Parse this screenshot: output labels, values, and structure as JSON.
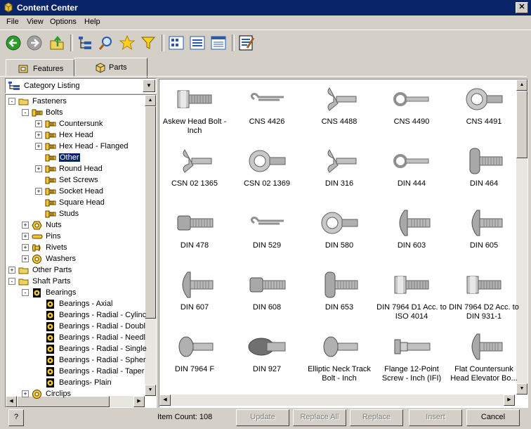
{
  "window": {
    "title": "Content Center",
    "close_glyph": "✕"
  },
  "menu": [
    "File",
    "View",
    "Options",
    "Help"
  ],
  "toolbar": {
    "buttons": [
      "back-arrow-icon",
      "forward-arrow-icon",
      "up-folder-icon",
      "tree-view-icon",
      "search-icon",
      "favorites-star-icon",
      "filter-icon",
      "large-icons-view-icon",
      "list-view-icon",
      "details-view-icon",
      "table-view-icon"
    ]
  },
  "tabs": [
    {
      "label": "Features"
    },
    {
      "label": "Parts"
    }
  ],
  "left": {
    "combo_label": "Category Listing",
    "tree": [
      {
        "label": "Fasteners",
        "level": 0,
        "exp": "-",
        "icon": "folder"
      },
      {
        "label": "Bolts",
        "level": 1,
        "exp": "-",
        "icon": "bolt"
      },
      {
        "label": "Countersunk",
        "level": 2,
        "exp": "+",
        "icon": "bolt"
      },
      {
        "label": "Hex Head",
        "level": 2,
        "exp": "+",
        "icon": "bolt"
      },
      {
        "label": "Hex Head - Flanged",
        "level": 2,
        "exp": "+",
        "icon": "bolt"
      },
      {
        "label": "Other",
        "level": 2,
        "exp": "",
        "icon": "bolt",
        "selected": true
      },
      {
        "label": "Round Head",
        "level": 2,
        "exp": "+",
        "icon": "bolt"
      },
      {
        "label": "Set Screws",
        "level": 2,
        "exp": "",
        "icon": "bolt"
      },
      {
        "label": "Socket Head",
        "level": 2,
        "exp": "+",
        "icon": "bolt"
      },
      {
        "label": "Square Head",
        "level": 2,
        "exp": "",
        "icon": "bolt"
      },
      {
        "label": "Studs",
        "level": 2,
        "exp": "",
        "icon": "bolt"
      },
      {
        "label": "Nuts",
        "level": 1,
        "exp": "+",
        "icon": "nut"
      },
      {
        "label": "Pins",
        "level": 1,
        "exp": "+",
        "icon": "pin"
      },
      {
        "label": "Rivets",
        "level": 1,
        "exp": "+",
        "icon": "rivet"
      },
      {
        "label": "Washers",
        "level": 1,
        "exp": "+",
        "icon": "washer"
      },
      {
        "label": "Other Parts",
        "level": 0,
        "exp": "+",
        "icon": "folder"
      },
      {
        "label": "Shaft Parts",
        "level": 0,
        "exp": "-",
        "icon": "folder"
      },
      {
        "label": "Bearings",
        "level": 1,
        "exp": "-",
        "icon": "bearing"
      },
      {
        "label": "Bearings - Axial",
        "level": 2,
        "exp": "",
        "icon": "bearing"
      },
      {
        "label": "Bearings - Radial - Cylinc",
        "level": 2,
        "exp": "",
        "icon": "bearing"
      },
      {
        "label": "Bearings - Radial - Doubl",
        "level": 2,
        "exp": "",
        "icon": "bearing"
      },
      {
        "label": "Bearings - Radial - Needl",
        "level": 2,
        "exp": "",
        "icon": "bearing"
      },
      {
        "label": "Bearings - Radial - Single",
        "level": 2,
        "exp": "",
        "icon": "bearing"
      },
      {
        "label": "Bearings - Radial - Spher",
        "level": 2,
        "exp": "",
        "icon": "bearing"
      },
      {
        "label": "Bearings - Radial - Taper",
        "level": 2,
        "exp": "",
        "icon": "bearing"
      },
      {
        "label": "Bearings- Plain",
        "level": 2,
        "exp": "",
        "icon": "bearing"
      },
      {
        "label": "Circlips",
        "level": 1,
        "exp": "+",
        "icon": "washer"
      }
    ]
  },
  "items": [
    {
      "label": "Askew Head Bolt - Inch",
      "icon": "hex-bolt"
    },
    {
      "label": "CNS 4426",
      "icon": "cotter-pin"
    },
    {
      "label": "CNS 4488",
      "icon": "wing-bolt"
    },
    {
      "label": "CNS 4490",
      "icon": "eye-pin"
    },
    {
      "label": "CNS 4491",
      "icon": "eye-bolt"
    },
    {
      "label": "CSN 02 1365",
      "icon": "wing-bolt"
    },
    {
      "label": "CSN 02 1369",
      "icon": "eye-bolt"
    },
    {
      "label": "DIN 316",
      "icon": "wing-bolt"
    },
    {
      "label": "DIN 444",
      "icon": "eye-pin"
    },
    {
      "label": "DIN 464",
      "icon": "knurled-bolt"
    },
    {
      "label": "DIN 478",
      "icon": "square-bolt"
    },
    {
      "label": "DIN 529",
      "icon": "cotter-pin"
    },
    {
      "label": "DIN 580",
      "icon": "eye-bolt"
    },
    {
      "label": "DIN 603",
      "icon": "mushroom-bolt"
    },
    {
      "label": "DIN 605",
      "icon": "mushroom-bolt"
    },
    {
      "label": "DIN 607",
      "icon": "mushroom-bolt"
    },
    {
      "label": "DIN 608",
      "icon": "square-bolt"
    },
    {
      "label": "DIN 653",
      "icon": "knurled-bolt"
    },
    {
      "label": "DIN 7964 D1  Acc. to ISO 4014",
      "icon": "hex-bolt"
    },
    {
      "label": "DIN 7964 D2  Acc. to DIN 931-1",
      "icon": "hex-bolt"
    },
    {
      "label": "DIN 7964 F",
      "icon": "round-bolt"
    },
    {
      "label": "DIN 927",
      "icon": "slotted-bolt"
    },
    {
      "label": "Elliptic Neck Track Bolt - Inch",
      "icon": "round-bolt"
    },
    {
      "label": "Flange 12-Point Screw - Inch (IFI)",
      "icon": "flange-bolt"
    },
    {
      "label": "Flat Countersunk Head Elevator Bo...",
      "icon": "mushroom-bolt"
    }
  ],
  "status": {
    "item_count": "Item Count: 108",
    "help_glyph": "?",
    "buttons": [
      {
        "label": "Update",
        "enabled": false
      },
      {
        "label": "Replace All",
        "enabled": false
      },
      {
        "label": "Replace",
        "enabled": false
      },
      {
        "label": "Insert",
        "enabled": false
      },
      {
        "label": "Cancel",
        "enabled": true
      }
    ]
  }
}
